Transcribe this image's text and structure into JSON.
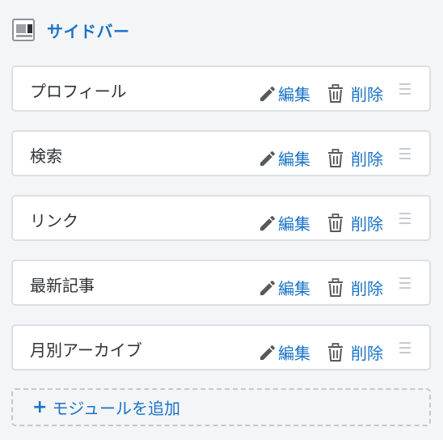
{
  "header": {
    "title": "サイドバー",
    "icon": "sidebar-layout-icon"
  },
  "modules": [
    {
      "name": "プロフィール",
      "edit_label": "編集",
      "delete_label": "削除"
    },
    {
      "name": "検索",
      "edit_label": "編集",
      "delete_label": "削除"
    },
    {
      "name": "リンク",
      "edit_label": "編集",
      "delete_label": "削除"
    },
    {
      "name": "最新記事",
      "edit_label": "編集",
      "delete_label": "削除"
    },
    {
      "name": "月別アーカイブ",
      "edit_label": "編集",
      "delete_label": "削除"
    }
  ],
  "add_button": {
    "icon": "+",
    "label": "モジュールを追加"
  },
  "colors": {
    "accent": "#1a73c6",
    "text": "#2f3336",
    "border": "#dcdfe3",
    "background": "#f4f5f7"
  }
}
